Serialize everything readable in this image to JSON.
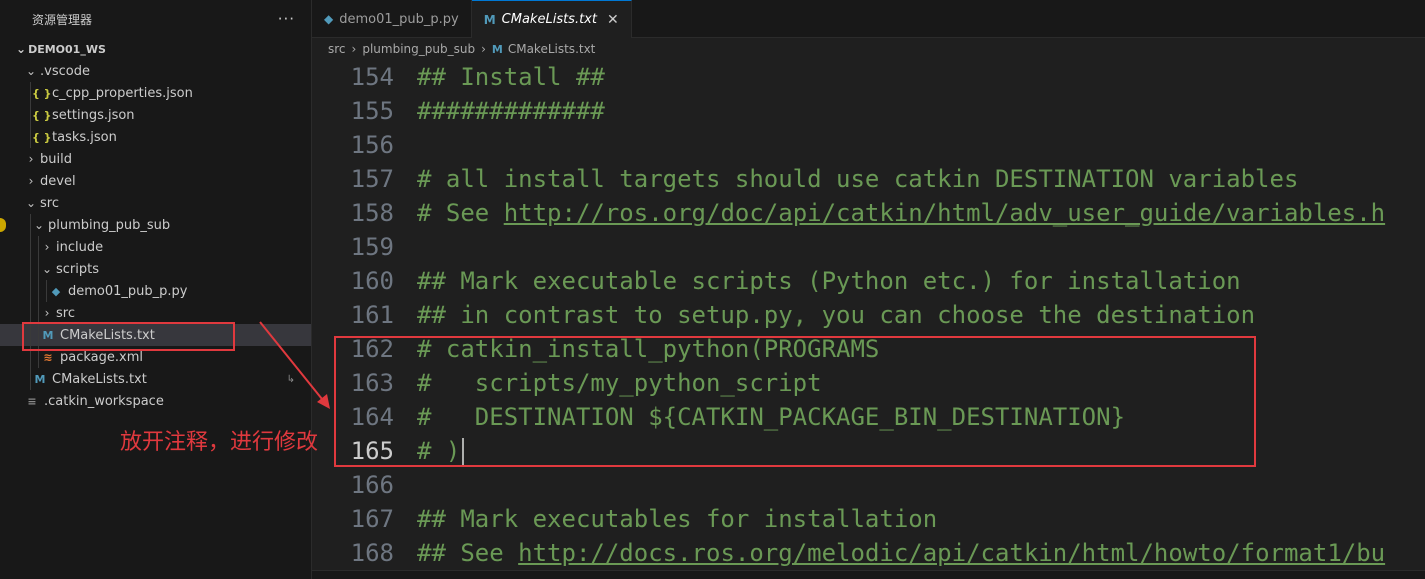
{
  "sidebar": {
    "title": "资源管理器",
    "more_label": "···",
    "workspace": "DEMO01_WS",
    "tree": [
      {
        "label": ".vscode",
        "depth": 1,
        "kind": "folder",
        "open": true,
        "name": "tree-folder-vscode"
      },
      {
        "label": "c_cpp_properties.json",
        "depth": 2,
        "kind": "json",
        "name": "tree-file-c-cpp-properties"
      },
      {
        "label": "settings.json",
        "depth": 2,
        "kind": "json",
        "name": "tree-file-settings-json"
      },
      {
        "label": "tasks.json",
        "depth": 2,
        "kind": "json",
        "name": "tree-file-tasks-json"
      },
      {
        "label": "build",
        "depth": 1,
        "kind": "folder",
        "open": false,
        "name": "tree-folder-build"
      },
      {
        "label": "devel",
        "depth": 1,
        "kind": "folder",
        "open": false,
        "name": "tree-folder-devel"
      },
      {
        "label": "src",
        "depth": 1,
        "kind": "folder",
        "open": true,
        "name": "tree-folder-src"
      },
      {
        "label": "plumbing_pub_sub",
        "depth": 2,
        "kind": "folder",
        "open": true,
        "name": "tree-folder-plumbing-pub-sub"
      },
      {
        "label": "include",
        "depth": 3,
        "kind": "folder",
        "open": false,
        "name": "tree-folder-include"
      },
      {
        "label": "scripts",
        "depth": 3,
        "kind": "folder",
        "open": true,
        "name": "tree-folder-scripts"
      },
      {
        "label": "demo01_pub_p.py",
        "depth": 4,
        "kind": "py",
        "name": "tree-file-demo01-pub-p"
      },
      {
        "label": "src",
        "depth": 3,
        "kind": "folder",
        "open": false,
        "name": "tree-folder-inner-src"
      },
      {
        "label": "CMakeLists.txt",
        "depth": 3,
        "kind": "cmake",
        "selected": true,
        "name": "tree-file-cmakelists-pkg"
      },
      {
        "label": "package.xml",
        "depth": 3,
        "kind": "xml",
        "name": "tree-file-package-xml"
      },
      {
        "label": "CMakeLists.txt",
        "depth": 2,
        "kind": "cmake",
        "name": "tree-file-cmakelists-src",
        "badge": "↳"
      },
      {
        "label": ".catkin_workspace",
        "depth": 1,
        "kind": "ws",
        "name": "tree-file-catkin-workspace"
      }
    ]
  },
  "tabs": [
    {
      "label": "demo01_pub_p.py",
      "icon": "python-icon",
      "active": false
    },
    {
      "label": "CMakeLists.txt",
      "icon": "cmake-icon",
      "active": true,
      "close": "✕"
    }
  ],
  "breadcrumb": [
    "src",
    "plumbing_pub_sub",
    "CMakeLists.txt"
  ],
  "editor": {
    "current_line": 165,
    "lines": [
      {
        "n": "154",
        "text": "## Install ##"
      },
      {
        "n": "155",
        "text": "#############"
      },
      {
        "n": "156",
        "text": ""
      },
      {
        "n": "157",
        "text": "# all install targets should use catkin DESTINATION variables"
      },
      {
        "n": "158",
        "text_prefix": "# See ",
        "link": "http://ros.org/doc/api/catkin/html/adv_user_guide/variables.h"
      },
      {
        "n": "159",
        "text": ""
      },
      {
        "n": "160",
        "text": "## Mark executable scripts (Python etc.) for installation"
      },
      {
        "n": "161",
        "text": "## in contrast to setup.py, you can choose the destination"
      },
      {
        "n": "162",
        "text": "# catkin_install_python(PROGRAMS"
      },
      {
        "n": "163",
        "text": "#   scripts/my_python_script"
      },
      {
        "n": "164",
        "text": "#   DESTINATION ${CATKIN_PACKAGE_BIN_DESTINATION}"
      },
      {
        "n": "165",
        "text": "# )"
      },
      {
        "n": "166",
        "text": ""
      },
      {
        "n": "167",
        "text": "## Mark executables for installation"
      },
      {
        "n": "168",
        "text_prefix": "## See ",
        "link": "http://docs.ros.org/melodic/api/catkin/html/howto/format1/bu"
      }
    ]
  },
  "annotation": {
    "text": "放开注释，进行修改",
    "color": "#e0393e"
  },
  "colors": {
    "comment": "#6a9955",
    "accent": "#0078d4",
    "highlight": "#e0393e"
  }
}
